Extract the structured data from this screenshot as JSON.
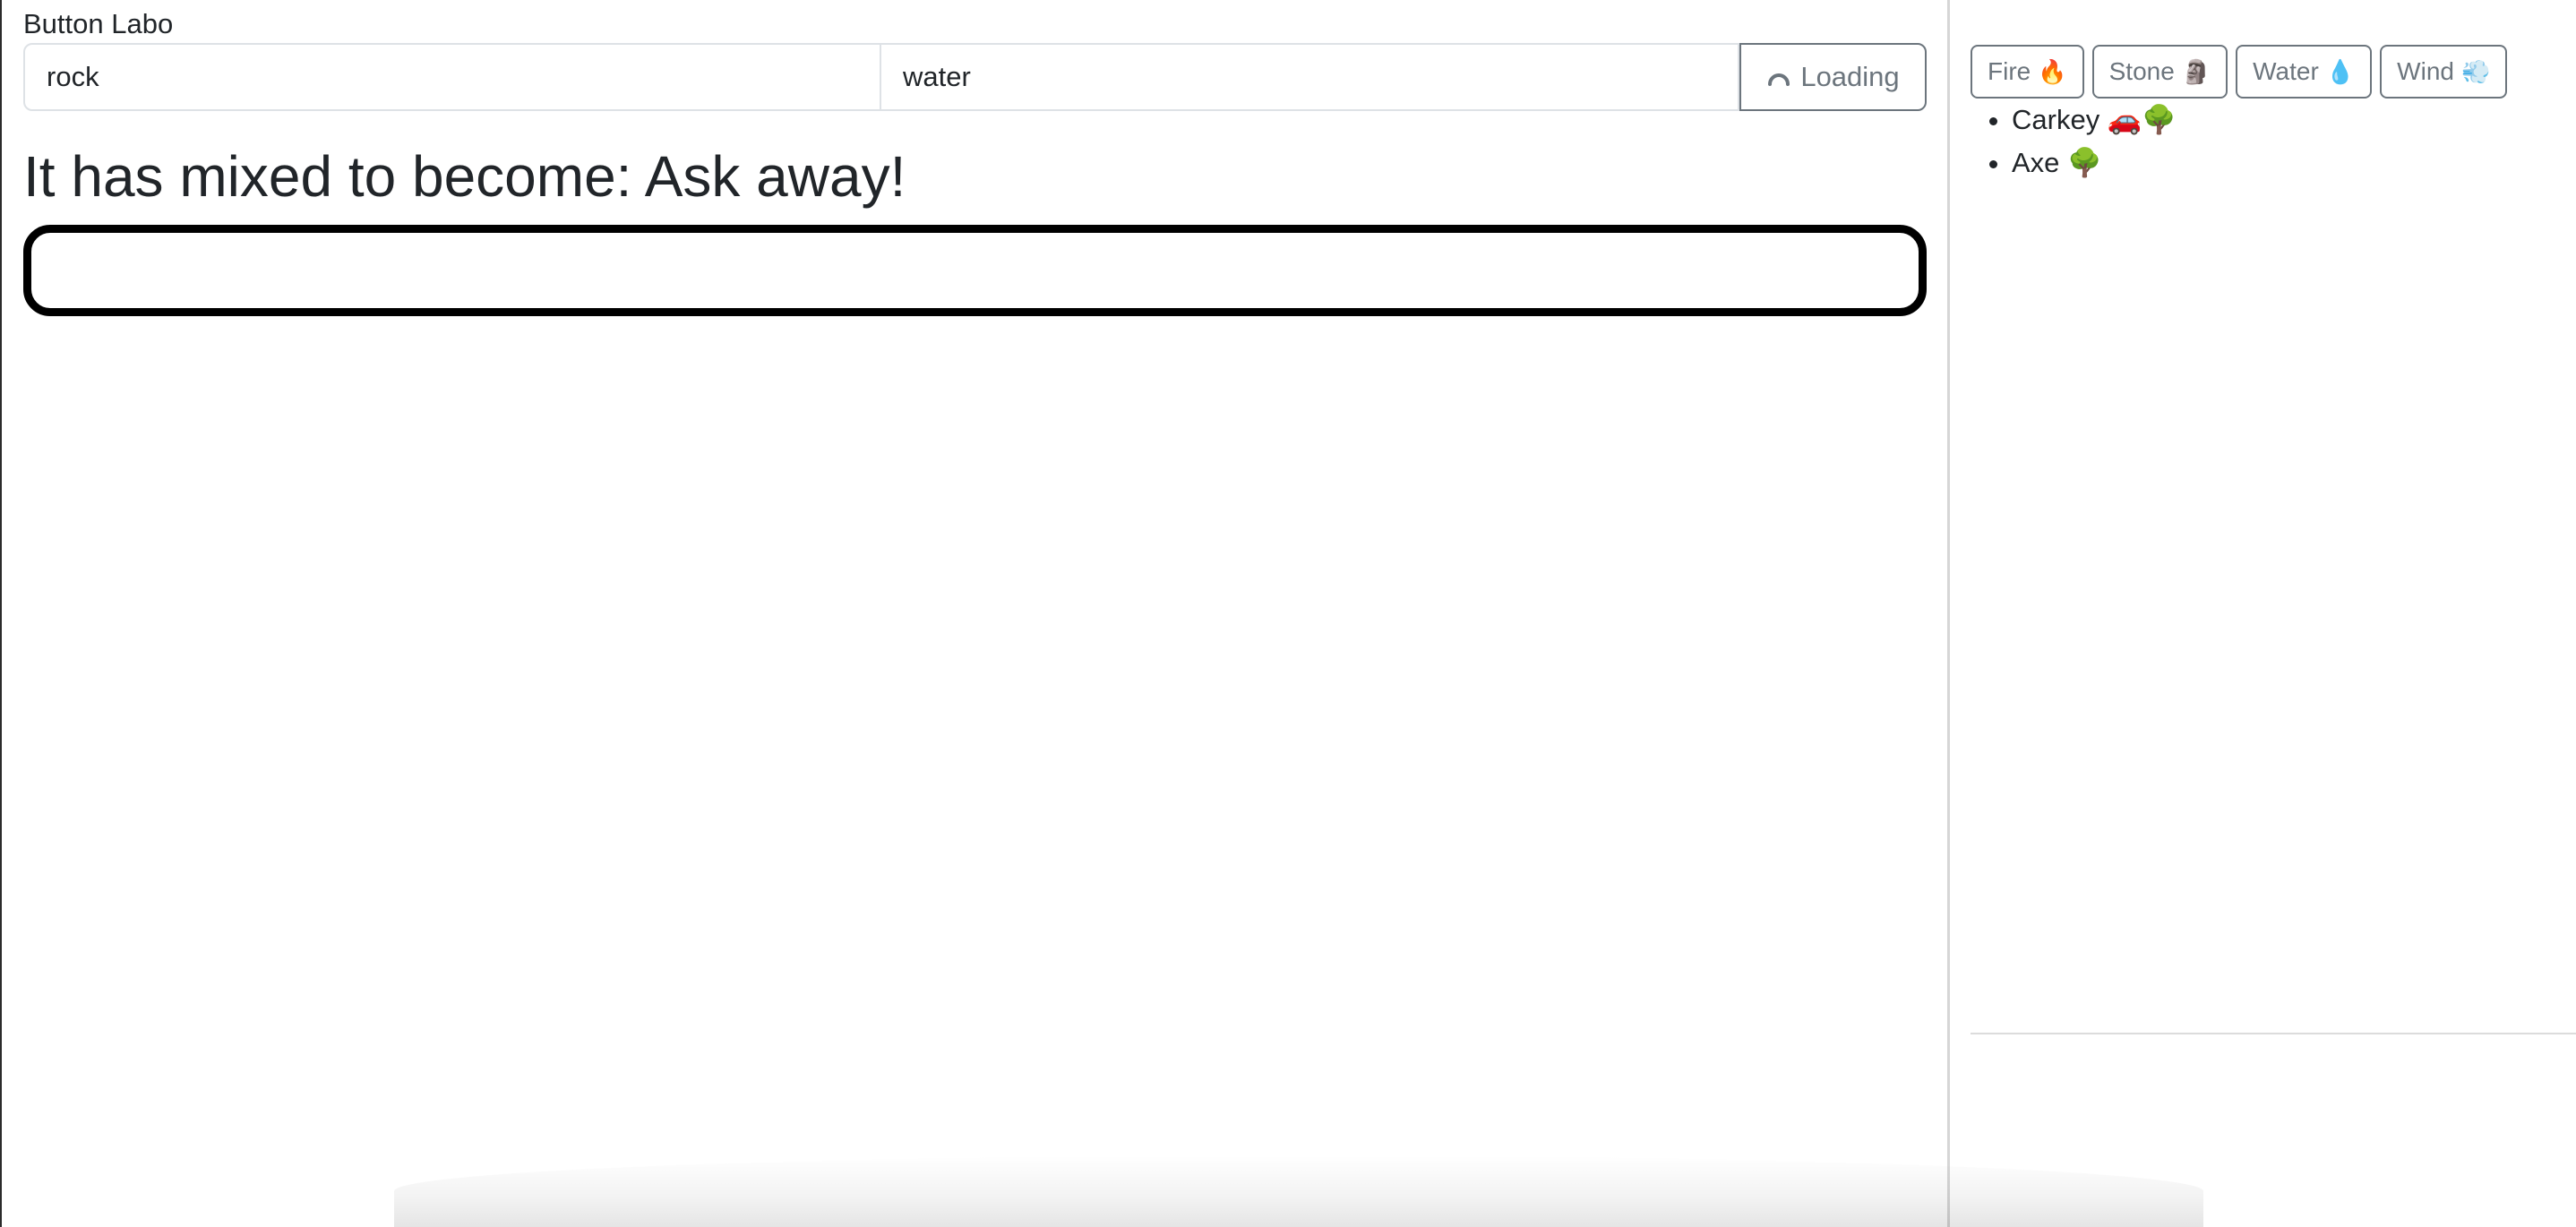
{
  "app": {
    "title": "Button Labo"
  },
  "mixer": {
    "first_value": "rock",
    "second_value": "water",
    "button": {
      "label": "Loading",
      "icon": "spinner-icon",
      "color": "#6c757d"
    }
  },
  "result": {
    "heading": "It has mixed to become: Ask away!",
    "answer_value": ""
  },
  "sidebar": {
    "elements": [
      {
        "label": "Fire",
        "emoji": "🔥"
      },
      {
        "label": "Stone",
        "emoji": "🗿"
      },
      {
        "label": "Water",
        "emoji": "💧"
      },
      {
        "label": "Wind",
        "emoji": "💨"
      }
    ],
    "recipes": [
      {
        "text": "Carkey 🚗🌳"
      },
      {
        "text": "Axe 🌳"
      }
    ]
  }
}
